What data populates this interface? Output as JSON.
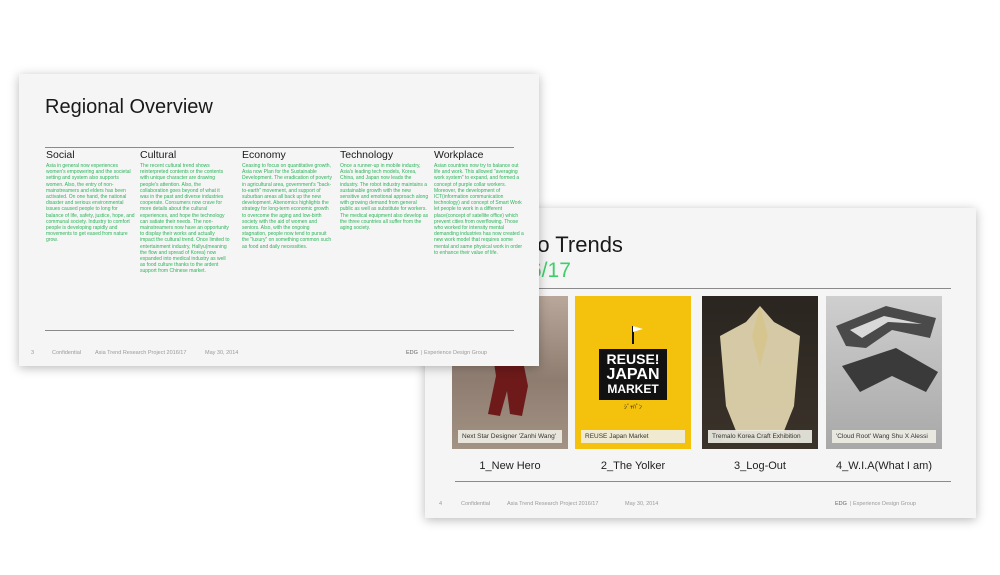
{
  "slide2": {
    "title": "ro Trends",
    "subtitle": "6/17",
    "cards": [
      {
        "caption": "Next Star Designer 'Zanhi Wang'",
        "label": "1_New Hero"
      },
      {
        "caption": "REUSE Japan Market",
        "label": "2_The Yolker",
        "logo_lines": [
          "REUSE!",
          "JAPAN",
          "MARKET"
        ],
        "logo_sub": "ｼﾞｬﾊﾟﾝ"
      },
      {
        "caption": "Tremalo Korea Craft Exhibition",
        "label": "3_Log-Out"
      },
      {
        "caption": "'Cloud Root' Wang Shu X Alessi",
        "label": "4_W.I.A(What I am)"
      }
    ],
    "footer": {
      "page": "4",
      "confidential": "Confidential",
      "project": "Asia  Trend  Research  Project 2016/17",
      "date": "May 30, 2014",
      "org": "EDG",
      "org_full": "|  Experience Design Group"
    }
  },
  "slide1": {
    "title": "Regional Overview",
    "columns": [
      {
        "head": "Social",
        "body": "Asia in general now experiences women's empowering and the societal setting and system also supports women. Also, the entry of non-mainstreamers and elders has been activated. On one hand, the national disaster and serious environmental issues caused people to long for balance of life, safety, justice, hope, and communal society. Industry to comfort people is developing rapidly and movements to get eased from nature grow."
      },
      {
        "head": "Cultural",
        "body": "The recent cultural trend shows reinterpreted contents or the contents with unique character are drawing people's attention. Also, the collaboration goes beyond of what it was in the past and diverse industries cooperate. Consumers now crave for more details about the cultural experiences, and hope the technology can satiate their needs. The non-mainstreamers now have an opportunity to display their works and actually impact the cultural trend. Once limited to entertainment industry, Hallyu(meaning the flow and spread of Korea) now expanded into medical industry as well as food culture thanks to the ardent support from Chinese market."
      },
      {
        "head": "Economy",
        "body": "Ceasing to focus on quantitative growth, Asia now Plan for the Sustainable Development. The eradication of poverty in agricultural area, government's \"back-to-earth\" movement, and support of suburban areas all back up the new development. Abenomics highlights the strategy for long-term economic growth to overcome the aging and low-birth society with the aid of women and seniors. Also, with the ongoing stagnation, people now tend to pursuit the \"luxury\" on something common such as food and daily necessities."
      },
      {
        "head": "Technology",
        "body": "Once a runner-up in mobile industry, Asia's leading tech models, Korea, China, and Japan now leads the industry. The robot industry maintains a sustainable growth with the new sensitive and emotional approach along with growing demand from general public as well as substitute for workers. The medical equipment also develop as the three countries all suffer from the aging society."
      },
      {
        "head": "Workplace",
        "body": "Asian countries now try to balance out life and work. This allowed \"averaging work system\" to expand, and formed a concept of purple collar workers. Moreover, the development of ICT(information communication technology) and concept of Smart Work let people to work in a different place(concept of satellite office) which prevent cities from overflowing. Those who worked for intensity mental demanding industries has now created a new work model that requires some mental and same physical work in order to enhance their value of life."
      }
    ],
    "footer": {
      "page": "3",
      "confidential": "Confidential",
      "project": "Asia  Trend  Research  Project 2016/17",
      "date": "May 30, 2014",
      "org": "EDG",
      "org_full": "|  Experience Design Group"
    }
  },
  "colors": {
    "accent_green": "#3fcf6a",
    "body_green": "#2bb559",
    "logo_yellow": "#f4c20d"
  }
}
